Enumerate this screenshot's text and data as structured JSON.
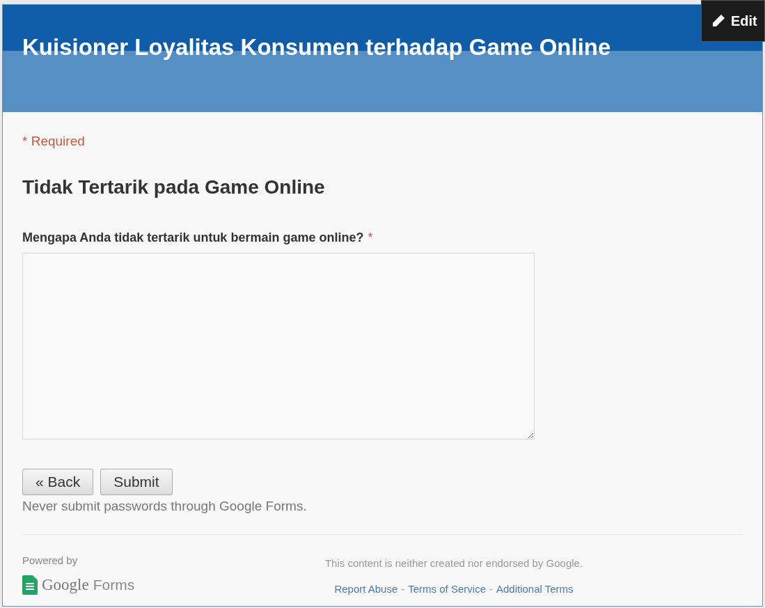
{
  "edit_button": {
    "label": "Edit"
  },
  "form": {
    "title": "Kuisioner Loyalitas Konsumen terhadap Game Online",
    "required_note": "* Required",
    "section_title": "Tidak Tertarik pada Game Online",
    "question": {
      "label": "Mengapa Anda tidak tertarik untuk bermain game online?",
      "required_mark": "*"
    },
    "buttons": [
      {
        "label": "« Back"
      },
      {
        "label": "Submit"
      }
    ],
    "password_warning": "Never submit passwords through Google Forms."
  },
  "footer": {
    "powered_by": "Powered by",
    "logo_word": "Google",
    "logo_product": "Forms",
    "disclaimer": "This content is neither created nor endorsed by Google.",
    "links": [
      "Report Abuse",
      "Terms of Service",
      "Additional Terms"
    ],
    "separator": "-"
  }
}
